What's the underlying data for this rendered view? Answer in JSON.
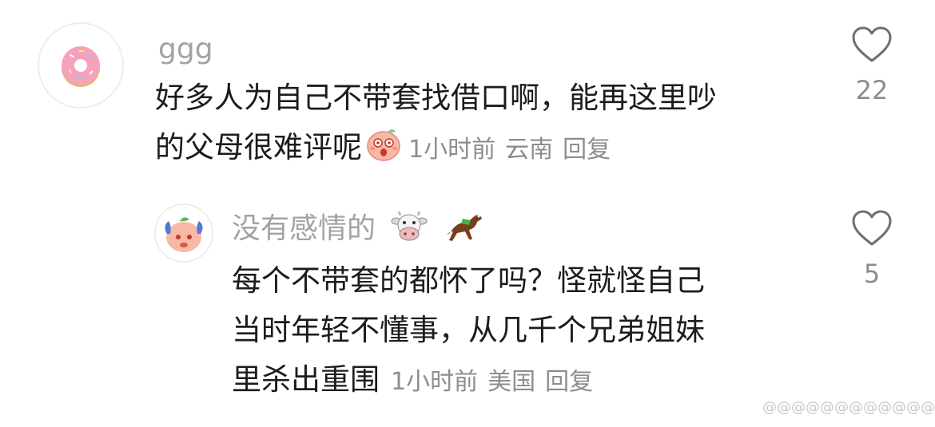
{
  "comment": {
    "username": "ggg",
    "avatar_icon": "donut-icon",
    "text_lines": [
      "好多人为自己不带套找借口啊，能再这里吵",
      "的父母很难评呢"
    ],
    "inline_emoji": "surprised-blush-emoji-icon",
    "time": "1小时前",
    "location": "云南",
    "reply_label": "回复",
    "like_count": "22"
  },
  "reply": {
    "username": "没有感情的",
    "username_emojis": [
      "cow-face-icon",
      "horse-racing-icon"
    ],
    "avatar_icon": "cartoon-avatar-icon",
    "text_lines": [
      "每个不带套的都怀了吗？怪就怪自己",
      "当时年轻不懂事，从几千个兄弟姐妹",
      "里杀出重围"
    ],
    "time": "1小时前",
    "location": "美国",
    "reply_label": "回复",
    "like_count": "5"
  },
  "watermark": "@@@@@@@@@@@@",
  "colors": {
    "text": "#1c1c1c",
    "meta": "#8d8d8d",
    "username": "#a3a3a3",
    "icon_stroke": "#6f6f6f"
  }
}
